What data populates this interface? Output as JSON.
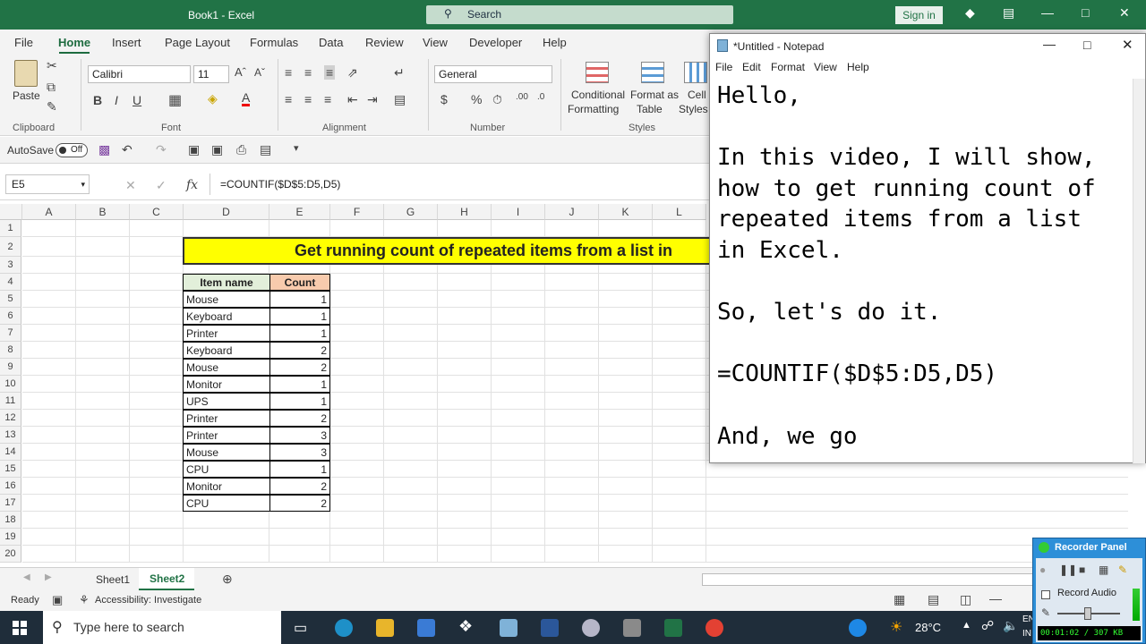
{
  "excel": {
    "window_title": "Book1  -  Excel",
    "search_placeholder": "Search",
    "sign_in": "Sign in",
    "menu": [
      "File",
      "Home",
      "Insert",
      "Page Layout",
      "Formulas",
      "Data",
      "Review",
      "View",
      "Developer",
      "Help"
    ],
    "ribbon": {
      "paste": "Paste",
      "clipboard": "Clipboard",
      "font_name": "Calibri",
      "font_size": "11",
      "font": "Font",
      "alignment": "Alignment",
      "number_format": "General",
      "number": "Number",
      "conditional_1": "Conditional",
      "conditional_2": "Formatting",
      "format_table_1": "Format as",
      "format_table_2": "Table",
      "cell_styles_1": "Cell",
      "cell_styles_2": "Styles",
      "styles": "Styles"
    },
    "autosave": "AutoSave",
    "autosave_state": "Off",
    "name_box": "E5",
    "formula": "=COUNTIF($D$5:D5,D5)",
    "columns": [
      "A",
      "B",
      "C",
      "D",
      "E",
      "F",
      "G",
      "H",
      "I",
      "J",
      "K",
      "L"
    ],
    "rows": [
      "1",
      "2",
      "3",
      "4",
      "5",
      "6",
      "7",
      "8",
      "9",
      "10",
      "11",
      "12",
      "13",
      "14",
      "15",
      "16",
      "17",
      "18",
      "19",
      "20"
    ],
    "sheet_title": "Get running count of repeated items from a list in",
    "table_headers": {
      "item": "Item name",
      "count": "Count"
    },
    "table_rows": [
      {
        "item": "Mouse",
        "count": "1"
      },
      {
        "item": "Keyboard",
        "count": "1"
      },
      {
        "item": "Printer",
        "count": "1"
      },
      {
        "item": "Keyboard",
        "count": "2"
      },
      {
        "item": "Mouse",
        "count": "2"
      },
      {
        "item": "Monitor",
        "count": "1"
      },
      {
        "item": "UPS",
        "count": "1"
      },
      {
        "item": "Printer",
        "count": "2"
      },
      {
        "item": "Printer",
        "count": "3"
      },
      {
        "item": "Mouse",
        "count": "3"
      },
      {
        "item": "CPU",
        "count": "1"
      },
      {
        "item": "Monitor",
        "count": "2"
      },
      {
        "item": "CPU",
        "count": "2"
      }
    ],
    "sheets": [
      "Sheet1",
      "Sheet2"
    ],
    "status_ready": "Ready",
    "accessibility": "Accessibility: Investigate",
    "colors": {
      "brand": "#217346",
      "title_fill": "#ffff00",
      "item_header": "#e2efda",
      "count_header": "#f8cbad"
    }
  },
  "notepad": {
    "title": "*Untitled - Notepad",
    "menu": [
      "File",
      "Edit",
      "Format",
      "View",
      "Help"
    ],
    "text": "Hello,\n\nIn this video, I will show,\nhow to get running count of\nrepeated items from a list\nin Excel.\n\nSo, let's do it.\n\n=COUNTIF($D$5:D5,D5)\n\nAnd, we go"
  },
  "taskbar": {
    "search_placeholder": "Type here to search",
    "temperature": "28°C",
    "lang_1": "EN",
    "lang_2": "IN"
  },
  "recorder": {
    "title": "Recorder Panel",
    "record_audio": "Record Audio",
    "timer": "00:01:02 / 307 KB"
  }
}
